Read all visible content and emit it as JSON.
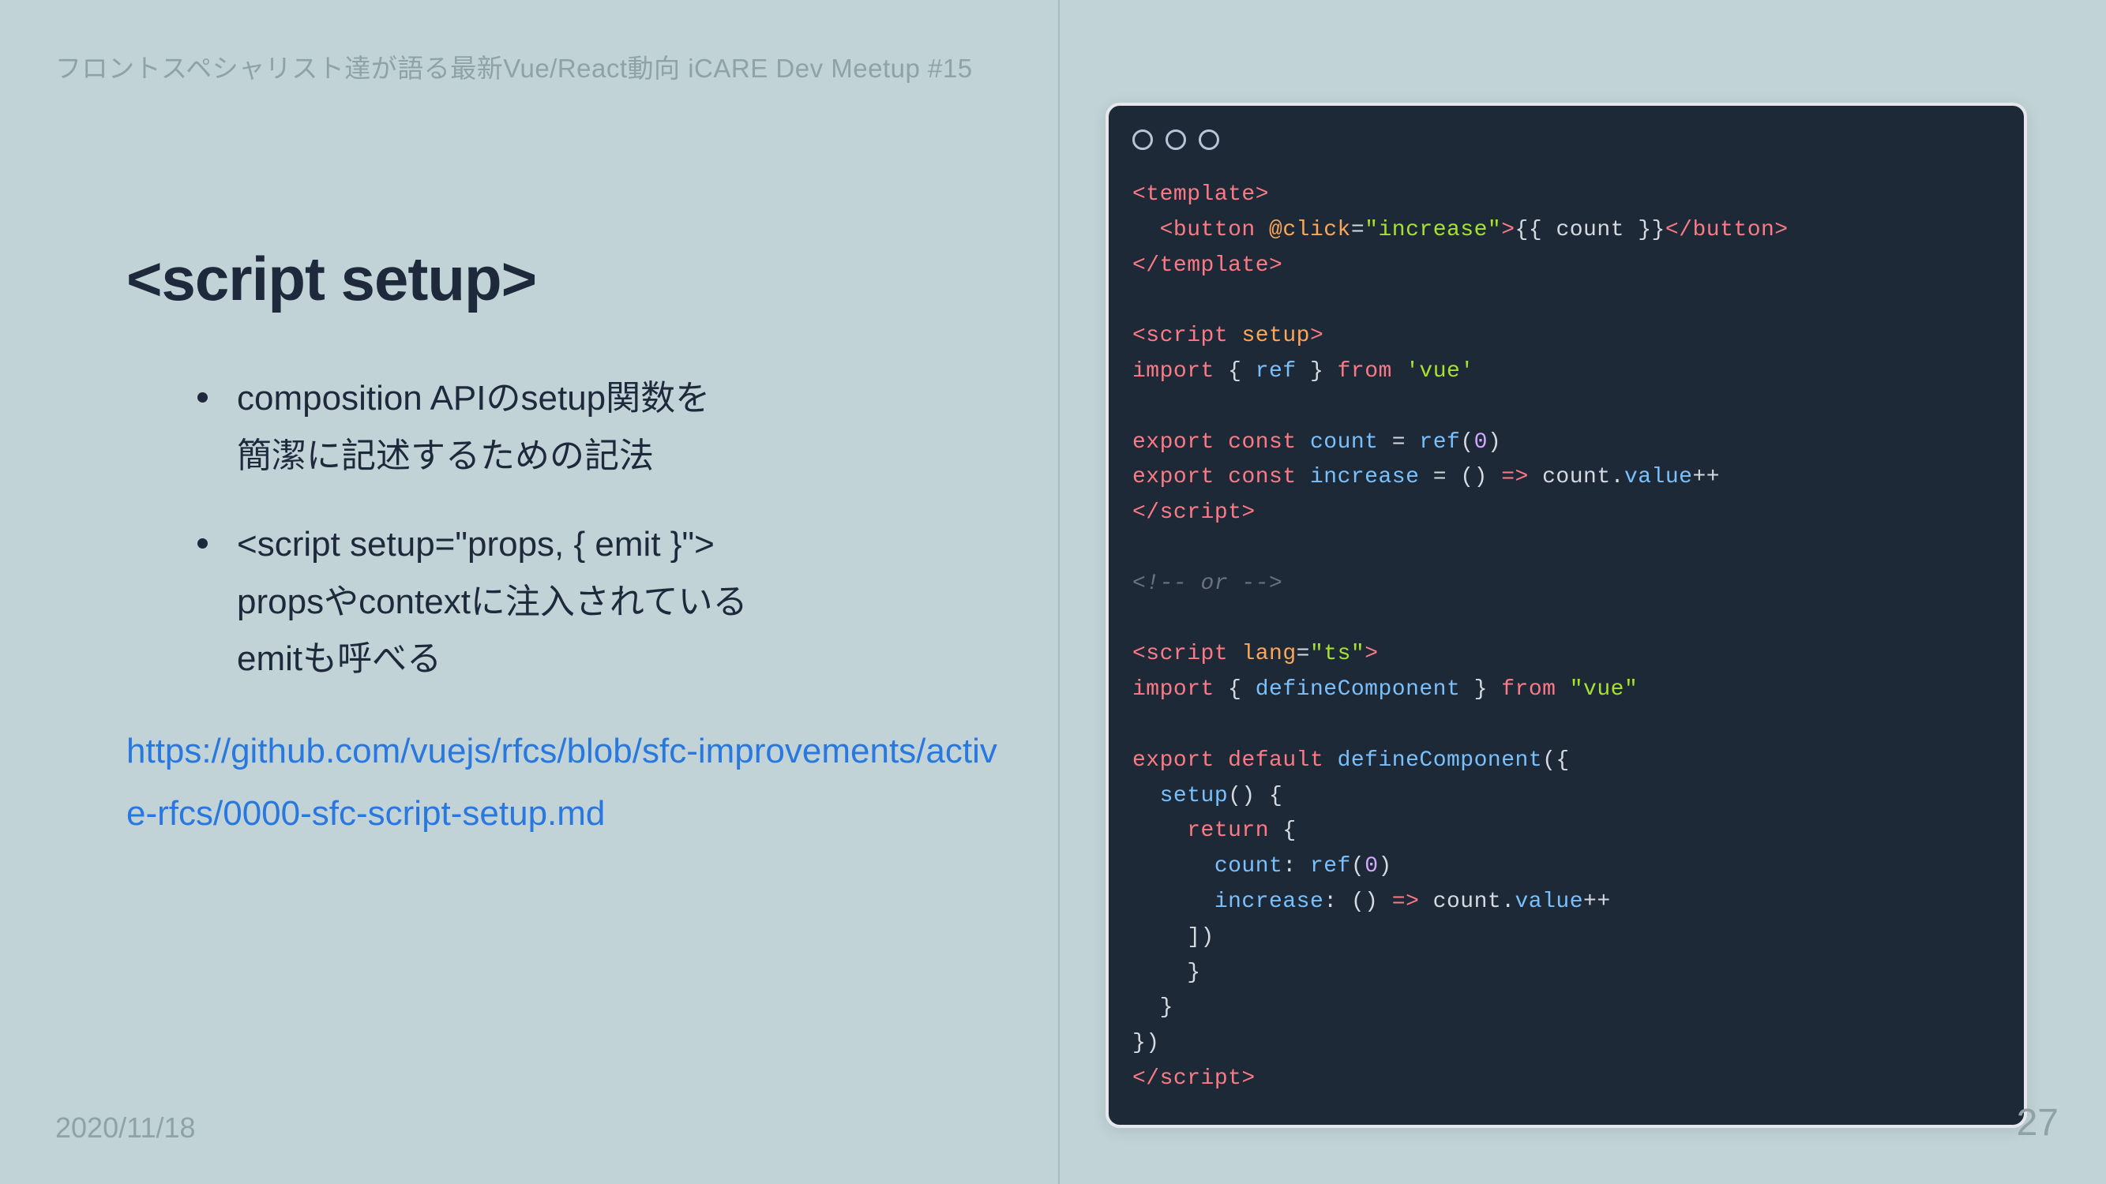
{
  "header": "フロントスペシャリスト達が語る最新Vue/React動向 iCARE Dev Meetup #15",
  "title": "<script setup>",
  "bullets": [
    {
      "line1": "composition APIのsetup関数を",
      "line2": "簡潔に記述するための記法"
    },
    {
      "line1": "<script setup=\"props, { emit }\">",
      "line2": "propsやcontextに注入されている",
      "line3": "emitも呼べる"
    }
  ],
  "link": "https://github.com/vuejs/rfcs/blob/sfc-improvements/active-rfcs/0000-sfc-script-setup.md",
  "footer_date": "2020/11/18",
  "page_number": "27",
  "code": {
    "lines": [
      [
        [
          "red",
          "<template>"
        ]
      ],
      [
        [
          "white",
          "  "
        ],
        [
          "red",
          "<button"
        ],
        [
          "white",
          " "
        ],
        [
          "orange",
          "@click"
        ],
        [
          "white",
          "="
        ],
        [
          "green",
          "\"increase\""
        ],
        [
          "red",
          ">"
        ],
        [
          "white",
          "{{ count }}"
        ],
        [
          "red",
          "</button>"
        ]
      ],
      [
        [
          "red",
          "</template>"
        ]
      ],
      [
        [
          "white",
          ""
        ]
      ],
      [
        [
          "red",
          "<script"
        ],
        [
          "white",
          " "
        ],
        [
          "orange",
          "setup"
        ],
        [
          "red",
          ">"
        ]
      ],
      [
        [
          "red",
          "import"
        ],
        [
          "white",
          " { "
        ],
        [
          "blue",
          "ref"
        ],
        [
          "white",
          " } "
        ],
        [
          "red",
          "from"
        ],
        [
          "white",
          " "
        ],
        [
          "green",
          "'vue'"
        ]
      ],
      [
        [
          "white",
          ""
        ]
      ],
      [
        [
          "red",
          "export"
        ],
        [
          "white",
          " "
        ],
        [
          "red",
          "const"
        ],
        [
          "white",
          " "
        ],
        [
          "blue",
          "count"
        ],
        [
          "white",
          " = "
        ],
        [
          "blue",
          "ref"
        ],
        [
          "white",
          "("
        ],
        [
          "purple",
          "0"
        ],
        [
          "white",
          ")"
        ]
      ],
      [
        [
          "red",
          "export"
        ],
        [
          "white",
          " "
        ],
        [
          "red",
          "const"
        ],
        [
          "white",
          " "
        ],
        [
          "blue",
          "increase"
        ],
        [
          "white",
          " = () "
        ],
        [
          "red",
          "=>"
        ],
        [
          "white",
          " count."
        ],
        [
          "blue",
          "value"
        ],
        [
          "white",
          "++"
        ]
      ],
      [
        [
          "red",
          "</script>"
        ]
      ],
      [
        [
          "white",
          ""
        ]
      ],
      [
        [
          "gray",
          "<!-- or -->"
        ]
      ],
      [
        [
          "white",
          ""
        ]
      ],
      [
        [
          "red",
          "<script"
        ],
        [
          "white",
          " "
        ],
        [
          "orange",
          "lang"
        ],
        [
          "white",
          "="
        ],
        [
          "green",
          "\"ts\""
        ],
        [
          "red",
          ">"
        ]
      ],
      [
        [
          "red",
          "import"
        ],
        [
          "white",
          " { "
        ],
        [
          "blue",
          "defineComponent"
        ],
        [
          "white",
          " } "
        ],
        [
          "red",
          "from"
        ],
        [
          "white",
          " "
        ],
        [
          "green",
          "\"vue\""
        ]
      ],
      [
        [
          "white",
          ""
        ]
      ],
      [
        [
          "red",
          "export"
        ],
        [
          "white",
          " "
        ],
        [
          "red",
          "default"
        ],
        [
          "white",
          " "
        ],
        [
          "blue",
          "defineComponent"
        ],
        [
          "white",
          "({"
        ]
      ],
      [
        [
          "white",
          "  "
        ],
        [
          "blue",
          "setup"
        ],
        [
          "white",
          "() {"
        ]
      ],
      [
        [
          "white",
          "    "
        ],
        [
          "red",
          "return"
        ],
        [
          "white",
          " {"
        ]
      ],
      [
        [
          "white",
          "      "
        ],
        [
          "blue",
          "count"
        ],
        [
          "white",
          ": "
        ],
        [
          "blue",
          "ref"
        ],
        [
          "white",
          "("
        ],
        [
          "purple",
          "0"
        ],
        [
          "white",
          ")"
        ]
      ],
      [
        [
          "white",
          "      "
        ],
        [
          "blue",
          "increase"
        ],
        [
          "white",
          ": () "
        ],
        [
          "red",
          "=>"
        ],
        [
          "white",
          " count."
        ],
        [
          "blue",
          "value"
        ],
        [
          "white",
          "++"
        ]
      ],
      [
        [
          "white",
          "    ])"
        ]
      ],
      [
        [
          "white",
          "    }"
        ]
      ],
      [
        [
          "white",
          "  }"
        ]
      ],
      [
        [
          "white",
          "})"
        ]
      ],
      [
        [
          "red",
          "</script>"
        ]
      ]
    ]
  }
}
